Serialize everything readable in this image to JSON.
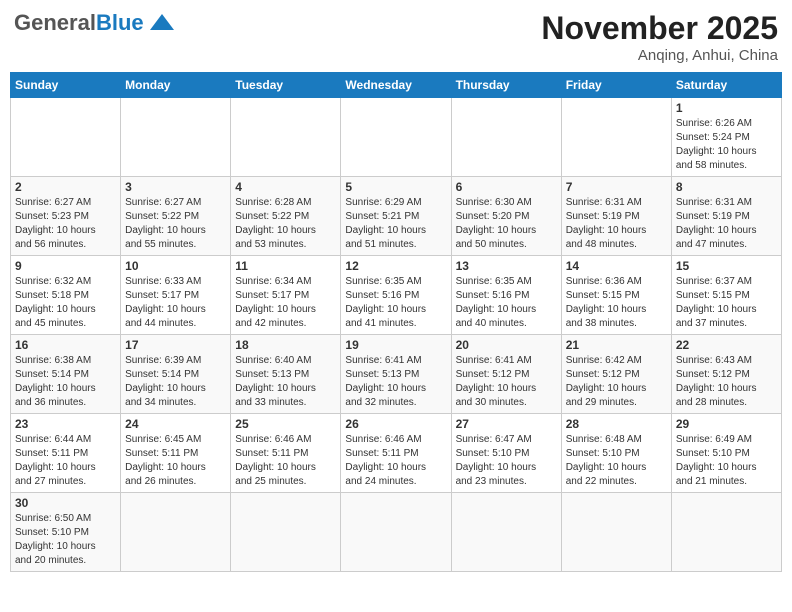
{
  "header": {
    "logo_general": "General",
    "logo_blue": "Blue",
    "month_title": "November 2025",
    "location": "Anqing, Anhui, China"
  },
  "weekdays": [
    "Sunday",
    "Monday",
    "Tuesday",
    "Wednesday",
    "Thursday",
    "Friday",
    "Saturday"
  ],
  "days": [
    {
      "num": "",
      "info": ""
    },
    {
      "num": "",
      "info": ""
    },
    {
      "num": "",
      "info": ""
    },
    {
      "num": "",
      "info": ""
    },
    {
      "num": "",
      "info": ""
    },
    {
      "num": "",
      "info": ""
    },
    {
      "num": "1",
      "info": "Sunrise: 6:26 AM\nSunset: 5:24 PM\nDaylight: 10 hours\nand 58 minutes."
    },
    {
      "num": "2",
      "info": "Sunrise: 6:27 AM\nSunset: 5:23 PM\nDaylight: 10 hours\nand 56 minutes."
    },
    {
      "num": "3",
      "info": "Sunrise: 6:27 AM\nSunset: 5:22 PM\nDaylight: 10 hours\nand 55 minutes."
    },
    {
      "num": "4",
      "info": "Sunrise: 6:28 AM\nSunset: 5:22 PM\nDaylight: 10 hours\nand 53 minutes."
    },
    {
      "num": "5",
      "info": "Sunrise: 6:29 AM\nSunset: 5:21 PM\nDaylight: 10 hours\nand 51 minutes."
    },
    {
      "num": "6",
      "info": "Sunrise: 6:30 AM\nSunset: 5:20 PM\nDaylight: 10 hours\nand 50 minutes."
    },
    {
      "num": "7",
      "info": "Sunrise: 6:31 AM\nSunset: 5:19 PM\nDaylight: 10 hours\nand 48 minutes."
    },
    {
      "num": "8",
      "info": "Sunrise: 6:31 AM\nSunset: 5:19 PM\nDaylight: 10 hours\nand 47 minutes."
    },
    {
      "num": "9",
      "info": "Sunrise: 6:32 AM\nSunset: 5:18 PM\nDaylight: 10 hours\nand 45 minutes."
    },
    {
      "num": "10",
      "info": "Sunrise: 6:33 AM\nSunset: 5:17 PM\nDaylight: 10 hours\nand 44 minutes."
    },
    {
      "num": "11",
      "info": "Sunrise: 6:34 AM\nSunset: 5:17 PM\nDaylight: 10 hours\nand 42 minutes."
    },
    {
      "num": "12",
      "info": "Sunrise: 6:35 AM\nSunset: 5:16 PM\nDaylight: 10 hours\nand 41 minutes."
    },
    {
      "num": "13",
      "info": "Sunrise: 6:35 AM\nSunset: 5:16 PM\nDaylight: 10 hours\nand 40 minutes."
    },
    {
      "num": "14",
      "info": "Sunrise: 6:36 AM\nSunset: 5:15 PM\nDaylight: 10 hours\nand 38 minutes."
    },
    {
      "num": "15",
      "info": "Sunrise: 6:37 AM\nSunset: 5:15 PM\nDaylight: 10 hours\nand 37 minutes."
    },
    {
      "num": "16",
      "info": "Sunrise: 6:38 AM\nSunset: 5:14 PM\nDaylight: 10 hours\nand 36 minutes."
    },
    {
      "num": "17",
      "info": "Sunrise: 6:39 AM\nSunset: 5:14 PM\nDaylight: 10 hours\nand 34 minutes."
    },
    {
      "num": "18",
      "info": "Sunrise: 6:40 AM\nSunset: 5:13 PM\nDaylight: 10 hours\nand 33 minutes."
    },
    {
      "num": "19",
      "info": "Sunrise: 6:41 AM\nSunset: 5:13 PM\nDaylight: 10 hours\nand 32 minutes."
    },
    {
      "num": "20",
      "info": "Sunrise: 6:41 AM\nSunset: 5:12 PM\nDaylight: 10 hours\nand 30 minutes."
    },
    {
      "num": "21",
      "info": "Sunrise: 6:42 AM\nSunset: 5:12 PM\nDaylight: 10 hours\nand 29 minutes."
    },
    {
      "num": "22",
      "info": "Sunrise: 6:43 AM\nSunset: 5:12 PM\nDaylight: 10 hours\nand 28 minutes."
    },
    {
      "num": "23",
      "info": "Sunrise: 6:44 AM\nSunset: 5:11 PM\nDaylight: 10 hours\nand 27 minutes."
    },
    {
      "num": "24",
      "info": "Sunrise: 6:45 AM\nSunset: 5:11 PM\nDaylight: 10 hours\nand 26 minutes."
    },
    {
      "num": "25",
      "info": "Sunrise: 6:46 AM\nSunset: 5:11 PM\nDaylight: 10 hours\nand 25 minutes."
    },
    {
      "num": "26",
      "info": "Sunrise: 6:46 AM\nSunset: 5:11 PM\nDaylight: 10 hours\nand 24 minutes."
    },
    {
      "num": "27",
      "info": "Sunrise: 6:47 AM\nSunset: 5:10 PM\nDaylight: 10 hours\nand 23 minutes."
    },
    {
      "num": "28",
      "info": "Sunrise: 6:48 AM\nSunset: 5:10 PM\nDaylight: 10 hours\nand 22 minutes."
    },
    {
      "num": "29",
      "info": "Sunrise: 6:49 AM\nSunset: 5:10 PM\nDaylight: 10 hours\nand 21 minutes."
    },
    {
      "num": "30",
      "info": "Sunrise: 6:50 AM\nSunset: 5:10 PM\nDaylight: 10 hours\nand 20 minutes."
    },
    {
      "num": "",
      "info": ""
    },
    {
      "num": "",
      "info": ""
    },
    {
      "num": "",
      "info": ""
    },
    {
      "num": "",
      "info": ""
    },
    {
      "num": "",
      "info": ""
    },
    {
      "num": "",
      "info": ""
    }
  ]
}
